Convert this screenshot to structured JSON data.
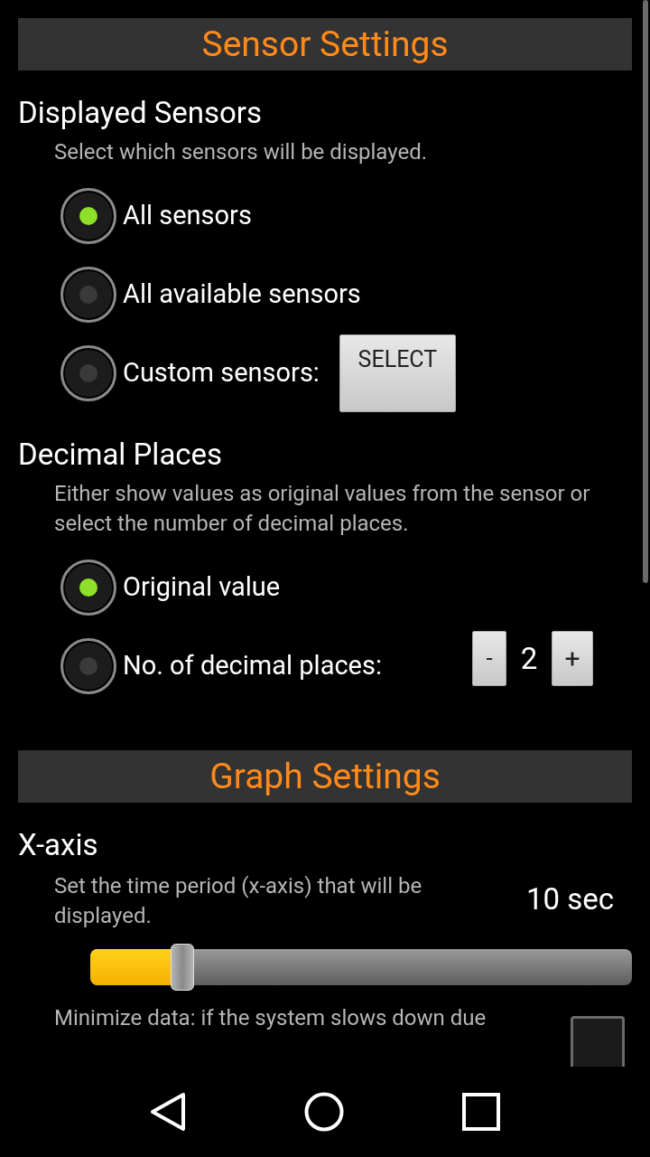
{
  "sections": [
    {
      "title": "Sensor Settings",
      "groups": [
        {
          "kind": "radio",
          "heading": "Displayed Sensors",
          "description": "Select which sensors will be displayed.",
          "options": [
            {
              "label": "All sensors",
              "selected": true
            },
            {
              "label": "All available sensors",
              "selected": false
            },
            {
              "label": "Custom sensors:",
              "selected": false,
              "button": "SELECT"
            }
          ]
        },
        {
          "kind": "radio",
          "heading": "Decimal Places",
          "description": "Either show values as original values from the sensor or select the number of decimal places.",
          "options": [
            {
              "label": "Original value",
              "selected": true
            },
            {
              "label": "No. of decimal places:",
              "selected": false,
              "stepper": {
                "minus": "-",
                "value": "2",
                "plus": "+"
              }
            }
          ]
        }
      ]
    },
    {
      "title": "Graph Settings",
      "groups": [
        {
          "kind": "slider",
          "heading": "X-axis",
          "description": "Set the time period (x-axis) that will be displayed.",
          "reading": "10 sec",
          "level": 0.17
        },
        {
          "kind": "checkbox",
          "description": "Minimize data: if the system slows down due",
          "checked": false
        }
      ]
    }
  ]
}
